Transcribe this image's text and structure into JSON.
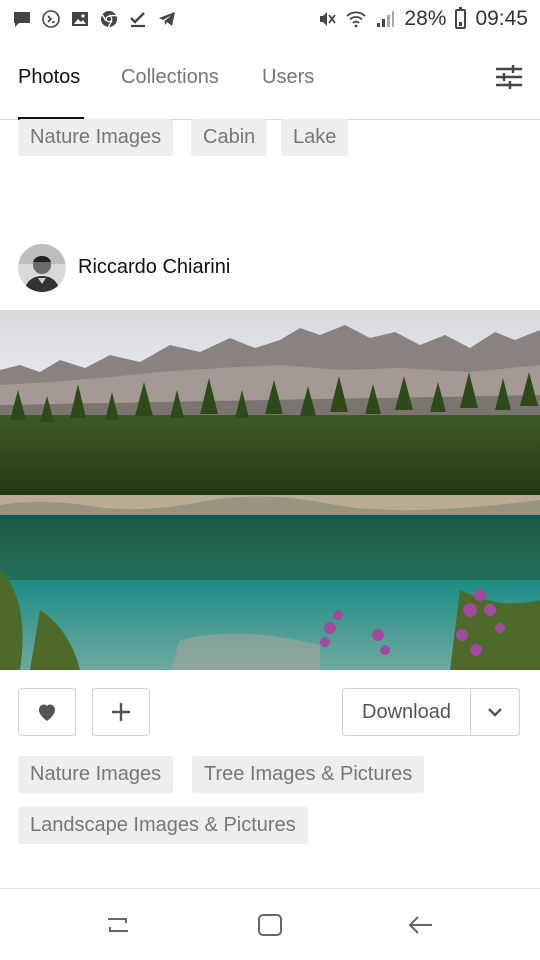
{
  "status_bar": {
    "battery_percent": "28%",
    "time": "09:45",
    "left_icons": [
      "message-icon",
      "phone-app-icon",
      "image-icon",
      "chrome-icon",
      "check-icon",
      "telegram-icon"
    ],
    "right_icons": [
      "mute-icon",
      "wifi-icon",
      "signal-icon",
      "battery-icon"
    ]
  },
  "tabs": [
    {
      "label": "Photos",
      "active": true
    },
    {
      "label": "Collections",
      "active": false
    },
    {
      "label": "Users",
      "active": false
    }
  ],
  "top_tags": [
    "Nature Images",
    "Cabin",
    "Lake"
  ],
  "post": {
    "author": "Riccardo Chiarini",
    "actions": {
      "like_icon": "heart-icon",
      "add_icon": "plus-icon",
      "download_label": "Download",
      "download_menu_icon": "chevron-down-icon"
    },
    "tags": [
      "Nature Images",
      "Tree Images & Pictures",
      "Landscape Images & Pictures"
    ]
  },
  "nav_bar": {
    "icons": [
      "recent-apps-icon",
      "home-icon",
      "back-icon"
    ]
  },
  "colors": {
    "text_primary": "#111111",
    "text_muted": "#767676",
    "tag_bg": "#eeeeee",
    "border": "#d1d1d1"
  }
}
